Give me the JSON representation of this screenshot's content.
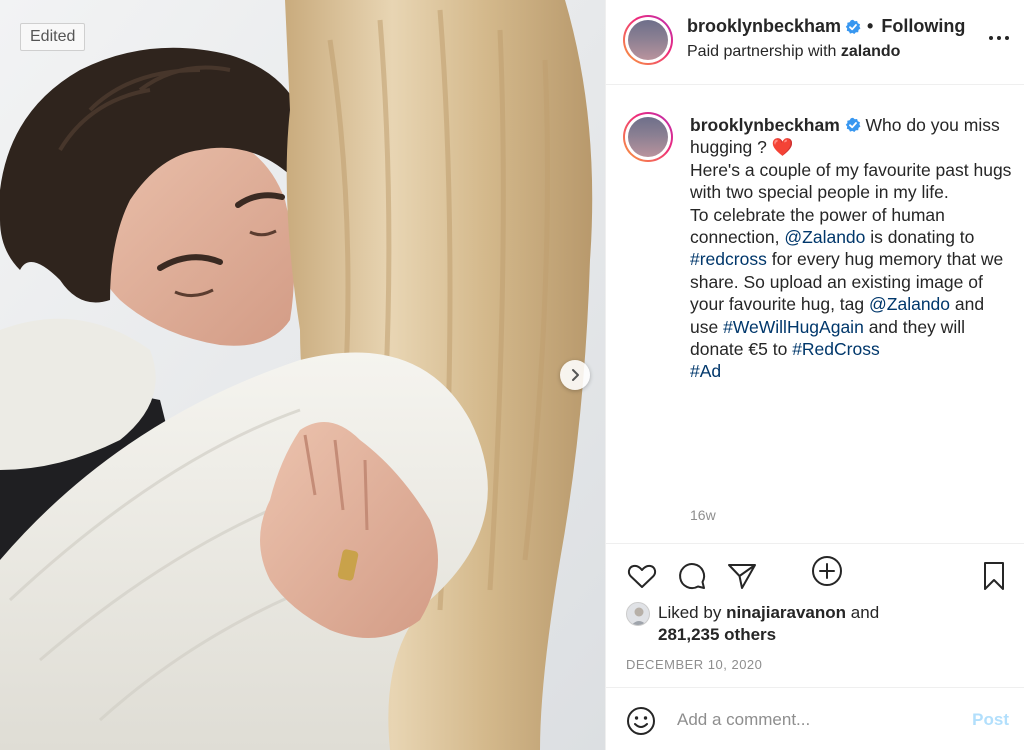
{
  "photo": {
    "badge": "Edited",
    "next_icon": "chevron-right-icon",
    "description_colors": {
      "hair_blonde": "#d8c09a",
      "hair_dark": "#2f241d",
      "sweater": "#f1efe9",
      "skin": "#e4b6a0",
      "background": "#eceef0"
    }
  },
  "header": {
    "username": "brooklynbeckham",
    "separator": "•",
    "follow_label": "Following",
    "paid_prefix": "Paid partnership with",
    "partner": "zalando",
    "more_icon": "more-options-icon"
  },
  "caption": {
    "username": "brooklynbeckham",
    "line1": "Who do you miss hugging ?",
    "emoji": "❤️",
    "line2": "Here's a couple of my favourite past hugs with two special people in my life.",
    "line3_a": "To celebrate the power of human connection,",
    "mention1": "@Zalando",
    "line3_b": "is donating to",
    "hashtag1": "#redcross",
    "line3_c": "for every hug memory that we share. So upload an existing image of your favourite hug, tag",
    "mention2": "@Zalando",
    "line3_d": "and use",
    "hashtag2": "#WeWillHugAgain",
    "line3_e": "and they will donate €5 to",
    "hashtag3": "#RedCross",
    "hashtag4": "#Ad",
    "time": "16w"
  },
  "actions": {
    "icons": [
      "heart-icon",
      "comment-icon",
      "share-icon",
      "bookmark-icon"
    ],
    "liked_prefix": "Liked by",
    "liked_user": "ninajiaravanon",
    "liked_and": "and",
    "liked_others": "281,235 others",
    "date": "DECEMBER 10, 2020"
  },
  "comment": {
    "placeholder": "Add a comment...",
    "post_label": "Post"
  },
  "colors": {
    "link": "#00376b",
    "verified": "#3897f0",
    "post_disabled": "#b2dffc",
    "muted": "#8e8e8e"
  }
}
